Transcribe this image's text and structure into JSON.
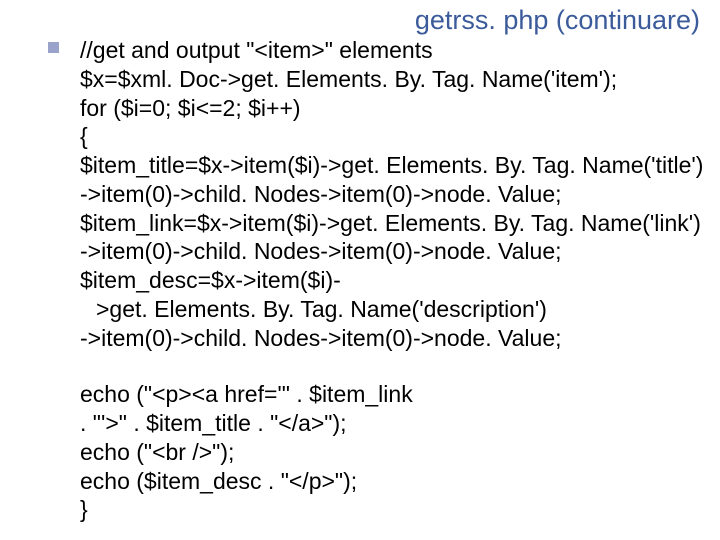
{
  "title": "getrss. php (continuare)",
  "code": {
    "l01": "//get and output \"<item>\" elements",
    "l02": "$x=$xml. Doc->get. Elements. By. Tag. Name('item');",
    "l03": "for ($i=0; $i<=2; $i++)",
    "l04": " {",
    "l05": "$item_title=$x->item($i)->get. Elements. By. Tag. Name('title')",
    "l06": "->item(0)->child. Nodes->item(0)->node. Value;",
    "l07": "$item_link=$x->item($i)->get. Elements. By. Tag. Name('link')",
    "l08": "->item(0)->child. Nodes->item(0)->node. Value;",
    "l09": "$item_desc=$x->item($i)-",
    "l10": ">get. Elements. By. Tag. Name('description')",
    "l11": "->item(0)->child. Nodes->item(0)->node. Value;",
    "l12": "echo (\"<p><a href='\" . $item_link",
    "l13": ". \"'>\" . $item_title . \"</a>\");",
    "l14": "echo (\"<br />\");",
    "l15": "echo ($item_desc . \"</p>\");",
    "l16": "}"
  }
}
